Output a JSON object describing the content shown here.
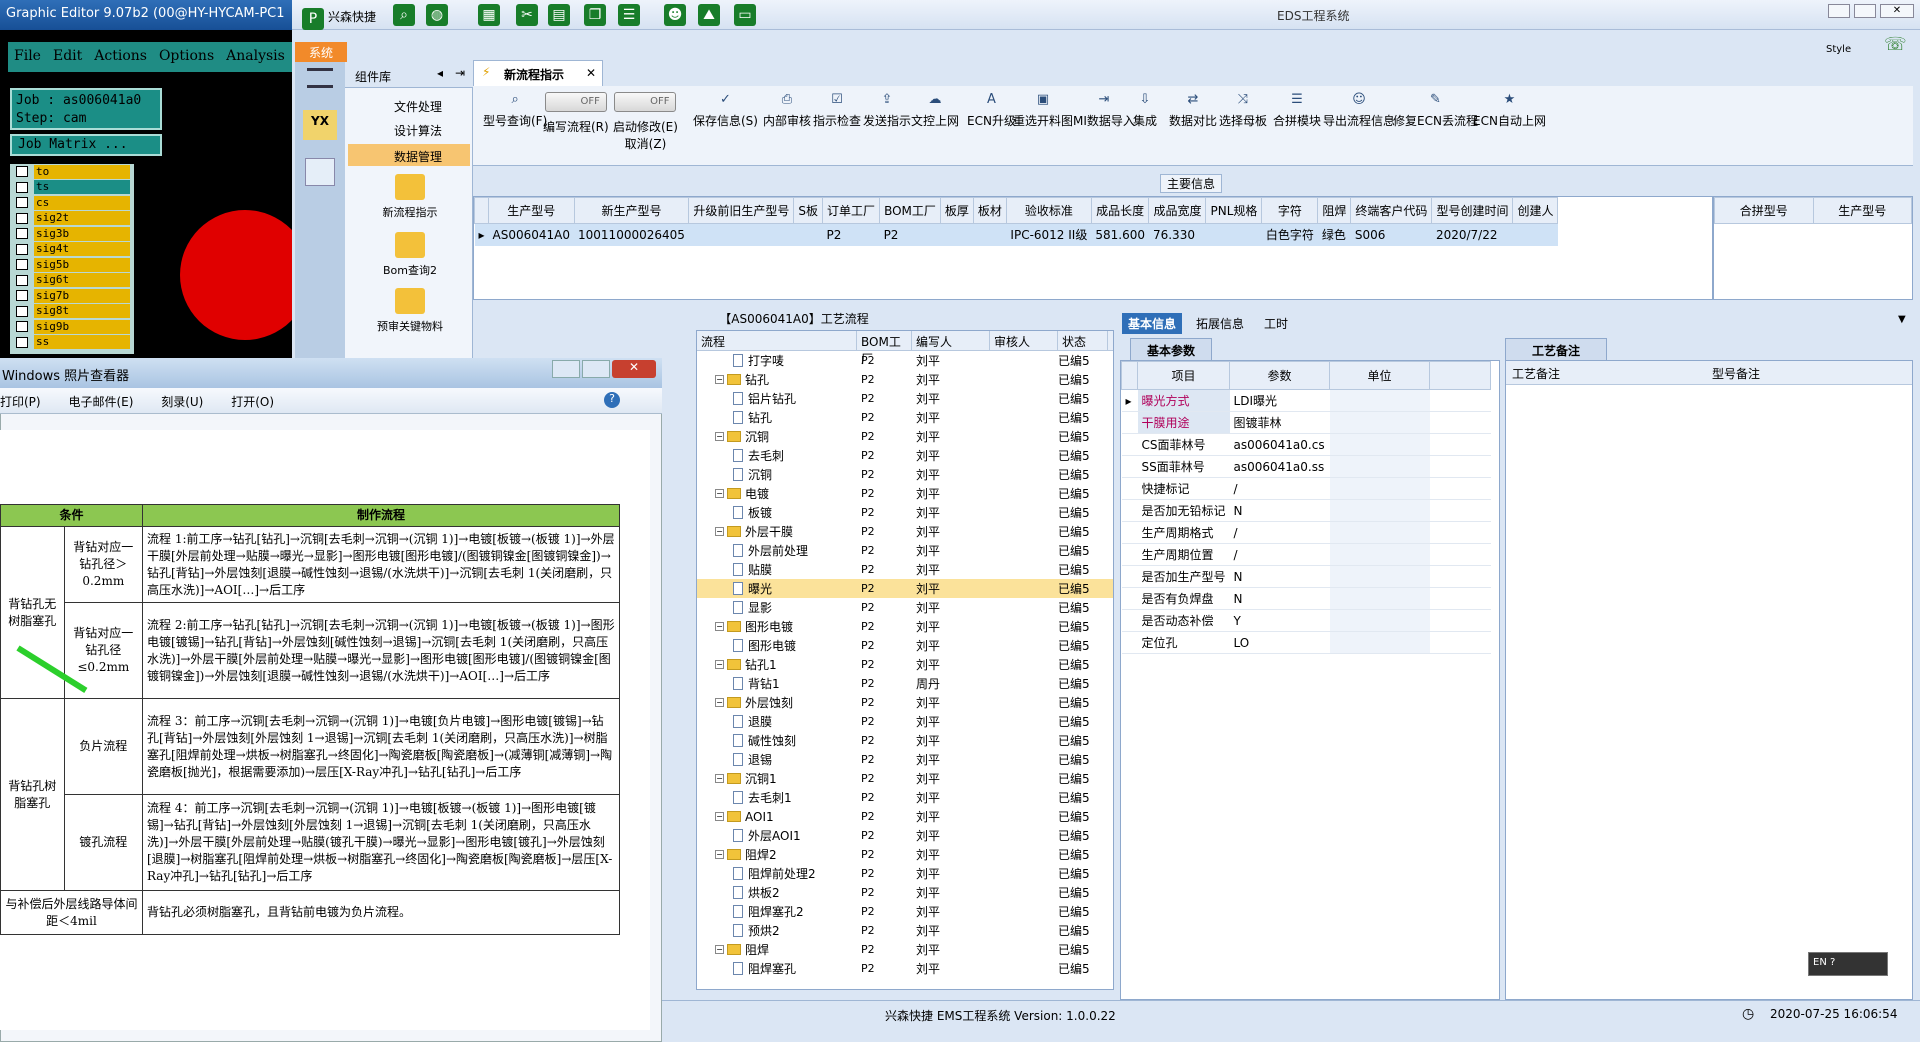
{
  "graphic_editor": {
    "title": "Graphic Editor 9.07b2 (00@HY-HYCAM-PC1",
    "menu": [
      "File",
      "Edit",
      "Actions",
      "Options",
      "Analysis"
    ],
    "job_line": "Job : as006041a0",
    "step_line": "Step: cam",
    "job_matrix_btn": "Job Matrix ...",
    "layers": [
      "to",
      "ts",
      "cs",
      "sig2t",
      "sig3b",
      "sig4t",
      "sig5b",
      "sig6t",
      "sig7b",
      "sig8t",
      "sig9b",
      "ss"
    ]
  },
  "eds": {
    "window_title": "EDS工程系统",
    "quick_access": "兴森快捷",
    "style_label": "Style",
    "sys_tab": "系统",
    "library_title": "组件库",
    "library_items": [
      "文件处理",
      "设计算法",
      "数据管理"
    ],
    "library_big": [
      "新流程指示",
      "Bom查询2",
      "预审关键物料"
    ],
    "doc_tab": "新流程指示",
    "ribbon": [
      {
        "icon": "⌕",
        "label": "型号查询(F)"
      },
      {
        "icon": "",
        "label": "编写流程(R)",
        "toggle": "OFF"
      },
      {
        "icon": "",
        "label": "启动修改(E)",
        "toggle": "OFF",
        "sub": "取消(Z)"
      },
      {
        "icon": "✓",
        "label": "保存信息(S)"
      },
      {
        "icon": "⎙",
        "label": "内部审核"
      },
      {
        "icon": "☑",
        "label": "指示检查"
      },
      {
        "icon": "⇪",
        "label": "发送指示"
      },
      {
        "icon": "☁",
        "label": "文控上网"
      },
      {
        "icon": "A",
        "label": "ECN升级"
      },
      {
        "icon": "▣",
        "label": "重选开料图"
      },
      {
        "icon": "⇥",
        "label": "MI数据导入"
      },
      {
        "icon": "⇩",
        "label": "集成"
      },
      {
        "icon": "⇄",
        "label": "数据对比"
      },
      {
        "icon": "⤨",
        "label": "选择母板"
      },
      {
        "icon": "☰",
        "label": "合拼模块"
      },
      {
        "icon": "☺",
        "label": "导出流程信息"
      },
      {
        "icon": "✎",
        "label": "修复ECN丢流程"
      },
      {
        "icon": "★",
        "label": "ECN自动上网"
      }
    ],
    "main_info_label": "主要信息",
    "main_columns": [
      "生产型号",
      "新生产型号",
      "升级前旧生产型号",
      "S板",
      "订单工厂",
      "BOM工厂",
      "板厚",
      "板材",
      "验收标准",
      "成品长度",
      "成品宽度",
      "PNL规格",
      "字符",
      "阻焊",
      "终端客户代码",
      "型号创建时间",
      "创建人"
    ],
    "main_row": [
      "AS006041A0",
      "10011000026405",
      "",
      "",
      "P2",
      "P2",
      "",
      "",
      "IPC-6012 II级",
      "581.600",
      "76.330",
      "",
      "白色字符",
      "绿色",
      "S006",
      "2020/7/22",
      ""
    ],
    "side_columns": [
      "合拼型号",
      "生产型号"
    ],
    "tree_title": "【AS006041A0】工艺流程",
    "tree_columns": [
      "流程",
      "BOM工厂",
      "编写人",
      "审核人",
      "状态"
    ],
    "tree_rows": [
      {
        "d": 2,
        "t": "doc",
        "n": "打字唛",
        "f": "P2",
        "w": "刘平",
        "s": "已编5"
      },
      {
        "d": 1,
        "t": "fold",
        "n": "钻孔",
        "f": "P2",
        "w": "刘平",
        "s": "已编5"
      },
      {
        "d": 2,
        "t": "doc",
        "n": "铝片钻孔",
        "f": "P2",
        "w": "刘平",
        "s": "已编5"
      },
      {
        "d": 2,
        "t": "doc",
        "n": "钻孔",
        "f": "P2",
        "w": "刘平",
        "s": "已编5"
      },
      {
        "d": 1,
        "t": "fold",
        "n": "沉铜",
        "f": "P2",
        "w": "刘平",
        "s": "已编5"
      },
      {
        "d": 2,
        "t": "doc",
        "n": "去毛刺",
        "f": "P2",
        "w": "刘平",
        "s": "已编5"
      },
      {
        "d": 2,
        "t": "doc",
        "n": "沉铜",
        "f": "P2",
        "w": "刘平",
        "s": "已编5"
      },
      {
        "d": 1,
        "t": "fold",
        "n": "电镀",
        "f": "P2",
        "w": "刘平",
        "s": "已编5"
      },
      {
        "d": 2,
        "t": "doc",
        "n": "板镀",
        "f": "P2",
        "w": "刘平",
        "s": "已编5"
      },
      {
        "d": 1,
        "t": "fold",
        "n": "外层干膜",
        "f": "P2",
        "w": "刘平",
        "s": "已编5"
      },
      {
        "d": 2,
        "t": "doc",
        "n": "外层前处理",
        "f": "P2",
        "w": "刘平",
        "s": "已编5"
      },
      {
        "d": 2,
        "t": "doc",
        "n": "贴膜",
        "f": "P2",
        "w": "刘平",
        "s": "已编5"
      },
      {
        "d": 2,
        "t": "doc",
        "n": "曝光",
        "f": "P2",
        "w": "刘平",
        "s": "已编5",
        "sel": true
      },
      {
        "d": 2,
        "t": "doc",
        "n": "显影",
        "f": "P2",
        "w": "刘平",
        "s": "已编5"
      },
      {
        "d": 1,
        "t": "fold",
        "n": "图形电镀",
        "f": "P2",
        "w": "刘平",
        "s": "已编5"
      },
      {
        "d": 2,
        "t": "doc",
        "n": "图形电镀",
        "f": "P2",
        "w": "刘平",
        "s": "已编5"
      },
      {
        "d": 1,
        "t": "fold",
        "n": "钻孔1",
        "f": "P2",
        "w": "刘平",
        "s": "已编5"
      },
      {
        "d": 2,
        "t": "doc",
        "n": "背钻1",
        "f": "P2",
        "w": "周丹",
        "s": "已编5"
      },
      {
        "d": 1,
        "t": "fold",
        "n": "外层蚀刻",
        "f": "P2",
        "w": "刘平",
        "s": "已编5"
      },
      {
        "d": 2,
        "t": "doc",
        "n": "退膜",
        "f": "P2",
        "w": "刘平",
        "s": "已编5"
      },
      {
        "d": 2,
        "t": "doc",
        "n": "碱性蚀刻",
        "f": "P2",
        "w": "刘平",
        "s": "已编5"
      },
      {
        "d": 2,
        "t": "doc",
        "n": "退锡",
        "f": "P2",
        "w": "刘平",
        "s": "已编5"
      },
      {
        "d": 1,
        "t": "fold",
        "n": "沉铜1",
        "f": "P2",
        "w": "刘平",
        "s": "已编5"
      },
      {
        "d": 2,
        "t": "doc",
        "n": "去毛刺1",
        "f": "P2",
        "w": "刘平",
        "s": "已编5"
      },
      {
        "d": 1,
        "t": "fold",
        "n": "AOI1",
        "f": "P2",
        "w": "刘平",
        "s": "已编5"
      },
      {
        "d": 2,
        "t": "doc",
        "n": "外层AOI1",
        "f": "P2",
        "w": "刘平",
        "s": "已编5"
      },
      {
        "d": 1,
        "t": "fold",
        "n": "阻焊2",
        "f": "P2",
        "w": "刘平",
        "s": "已编5"
      },
      {
        "d": 2,
        "t": "doc",
        "n": "阻焊前处理2",
        "f": "P2",
        "w": "刘平",
        "s": "已编5"
      },
      {
        "d": 2,
        "t": "doc",
        "n": "烘板2",
        "f": "P2",
        "w": "刘平",
        "s": "已编5"
      },
      {
        "d": 2,
        "t": "doc",
        "n": "阻焊塞孔2",
        "f": "P2",
        "w": "刘平",
        "s": "已编5"
      },
      {
        "d": 2,
        "t": "doc",
        "n": "预烘2",
        "f": "P2",
        "w": "刘平",
        "s": "已编5"
      },
      {
        "d": 1,
        "t": "fold",
        "n": "阻焊",
        "f": "P2",
        "w": "刘平",
        "s": "已编5"
      },
      {
        "d": 2,
        "t": "doc",
        "n": "阻焊塞孔",
        "f": "P2",
        "w": "刘平",
        "s": "已编5"
      }
    ],
    "info_tabs": [
      "基本信息",
      "拓展信息",
      "工时"
    ],
    "basic_params_label": "基本参数",
    "param_columns": [
      "项目",
      "参数",
      "单位"
    ],
    "params": [
      {
        "k": "曝光方式",
        "v": "LDI曝光",
        "hl": true
      },
      {
        "k": "干膜用途",
        "v": "图镀菲林",
        "hl": true
      },
      {
        "k": "CS面菲林号",
        "v": "as006041a0.cs"
      },
      {
        "k": "SS面菲林号",
        "v": "as006041a0.ss"
      },
      {
        "k": "快捷标记",
        "v": "/"
      },
      {
        "k": "是否加无铅标记",
        "v": "N"
      },
      {
        "k": "生产周期格式",
        "v": "/"
      },
      {
        "k": "生产周期位置",
        "v": "/"
      },
      {
        "k": "是否加生产型号",
        "v": "N"
      },
      {
        "k": "是否有负焊盘",
        "v": "N"
      },
      {
        "k": "是否动态补偿",
        "v": "Y"
      },
      {
        "k": "定位孔",
        "v": "LO"
      }
    ],
    "notes_tab": "工艺备注",
    "notes_columns": [
      "工艺备注",
      "型号备注"
    ],
    "status_version": "兴森快捷 EMS工程系统 Version: 1.0.0.22",
    "status_time": "2020-07-25 16:06:54",
    "lang": "EN"
  },
  "photo_viewer": {
    "title": "Windows 照片查看器",
    "menu": [
      "打印(P)",
      "电子邮件(E)",
      "刻录(U)",
      "打开(O)"
    ],
    "table_headers": [
      "条件",
      "制作流程"
    ],
    "rows": [
      {
        "c1": "背钻孔无树脂塞孔",
        "c2": "背钻对应一钻孔径＞0.2mm",
        "flow": "流程 1:前工序→钻孔[钻孔]→沉铜[去毛刺→沉铜→(沉铜 1)]→电镀[板镀→(板镀 1)]→外层干膜[外层前处理→贴膜→曝光→显影]→图形电镀[图形电镀]/(图镀铜镍金[图镀铜镍金])→钻孔[背钻]→外层蚀刻[退膜→碱性蚀刻→退锡/(水洗烘干)]→沉铜[去毛刺 1(关闭磨刷，只高压水洗)]→AOI[…]→后工序"
      },
      {
        "c1": "",
        "c2": "背钻对应一钻孔径≤0.2mm",
        "flow": "流程 2:前工序→钻孔[钻孔]→沉铜[去毛刺→沉铜→(沉铜 1)]→电镀[板镀→(板镀 1)]→图形电镀[镀锡]→钻孔[背钻]→外层蚀刻[碱性蚀刻→退锡]→沉铜[去毛刺 1(关闭磨刷，只高压水洗)]→外层干膜[外层前处理→贴膜→曝光→显影]→图形电镀[图形电镀]/(图镀铜镍金[图镀铜镍金])→外层蚀刻[退膜→碱性蚀刻→退锡/(水洗烘干)]→AOI[…]→后工序"
      },
      {
        "c1": "背钻孔树脂塞孔",
        "c2": "负片流程",
        "flow": "流程 3：前工序→沉铜[去毛刺→沉铜→(沉铜 1)]→电镀[负片电镀]→图形电镀[镀锡]→钻孔[背钻]→外层蚀刻[外层蚀刻 1→退锡]→沉铜[去毛刺 1(关闭磨刷，只高压水洗)]→树脂塞孔[阻焊前处理→烘板→树脂塞孔→终固化]→陶瓷磨板[陶瓷磨板]→(减薄铜[减薄铜]→陶瓷磨板[抛光]，根据需要添加)→层压[X-Ray冲孔]→钻孔[钻孔]→后工序"
      },
      {
        "c1": "",
        "c2": "镀孔流程",
        "flow": "流程 4：前工序→沉铜[去毛刺→沉铜→(沉铜 1)]→电镀[板镀→(板镀 1)]→图形电镀[镀锡]→钻孔[背钻]→外层蚀刻[外层蚀刻 1→退锡]→沉铜[去毛刺 1(关闭磨刷，只高压水洗)]→外层干膜[外层前处理→贴膜(镀孔干膜)→曝光→显影]→图形电镀[镀孔]→外层蚀刻[退膜]→树脂塞孔[阻焊前处理→烘板→树脂塞孔→终固化]→陶瓷磨板[陶瓷磨板]→层压[X-Ray冲孔]→钻孔[钻孔]→后工序"
      }
    ],
    "last_cond": "与补偿后外层线路导体间距＜4mil",
    "last_flow": "背钻孔必须树脂塞孔，且背钻前电镀为负片流程。"
  }
}
